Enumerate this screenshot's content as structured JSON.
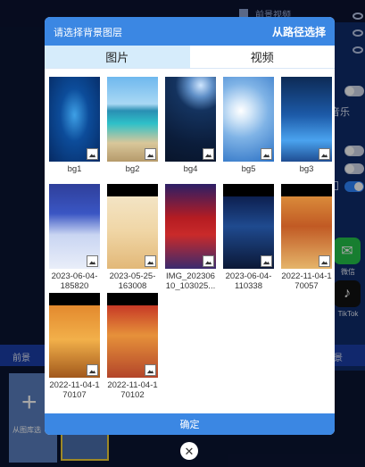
{
  "background": {
    "topbar_title": "前景视频",
    "music_label": "音乐",
    "bottombar_left": "前景",
    "bottombar_right": "景",
    "add_from_gallery_label": "从图库选",
    "apps": [
      {
        "name": "微信",
        "icon": "wechat-icon"
      },
      {
        "name": "TikTok",
        "icon": "tiktok-icon"
      }
    ]
  },
  "dialog": {
    "title": "请选择背景图层",
    "path_select": "从路径选择",
    "tabs": [
      {
        "label": "图片",
        "active": true
      },
      {
        "label": "视频",
        "active": false
      }
    ],
    "items": [
      {
        "caption": "bg1"
      },
      {
        "caption": "bg2"
      },
      {
        "caption": "bg4"
      },
      {
        "caption": "bg5"
      },
      {
        "caption": "bg3"
      },
      {
        "caption": "2023-06-04-185820"
      },
      {
        "caption": "2023-05-25-163008"
      },
      {
        "caption": "IMG_20230610_103025..."
      },
      {
        "caption": "2023-06-04-110338"
      },
      {
        "caption": "2022-11-04-170057"
      },
      {
        "caption": "2022-11-04-170107"
      },
      {
        "caption": "2022-11-04-170102"
      }
    ],
    "confirm_label": "确定"
  },
  "colors": {
    "accent": "#3b87e3",
    "tab_active_bg": "#d6ecfb"
  }
}
